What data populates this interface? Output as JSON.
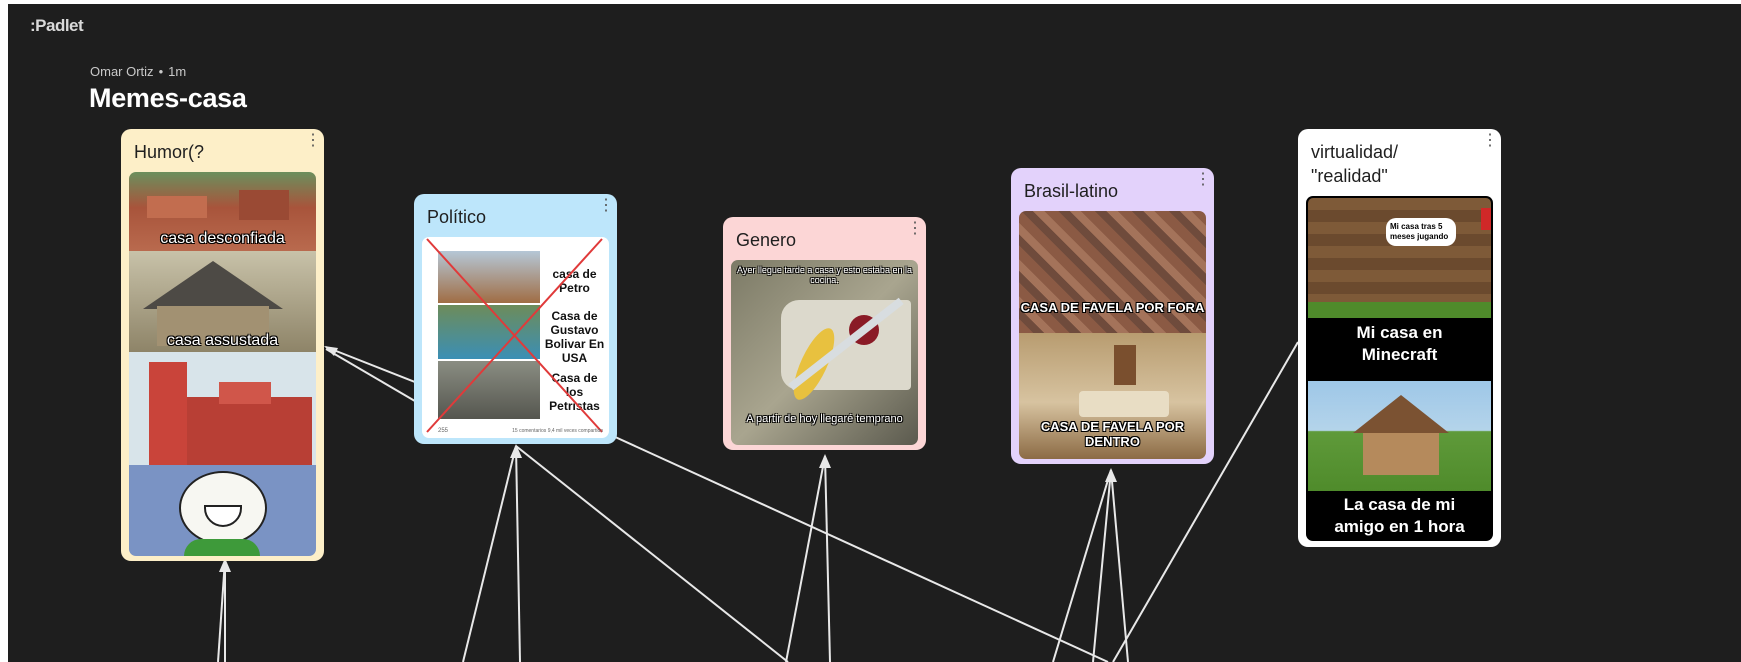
{
  "app": {
    "logo": ":Padlet"
  },
  "board": {
    "author": "Omar Ortiz",
    "time": "1m",
    "title": "Memes-casa"
  },
  "colors": {
    "background": "#1e1e1e",
    "humor": "#fdefc8",
    "politico": "#bde6fb",
    "genero": "#fcd6d6",
    "brasil": "#e3d2fb",
    "virtualidad": "#ffffff"
  },
  "cards": {
    "humor": {
      "title": "Humor(?",
      "captions": [
        "casa desconfiada",
        "casa assustada"
      ]
    },
    "politico": {
      "title": "Político",
      "captions": [
        "casa de Petro",
        "Casa de Gustavo Bolivar En USA",
        "Casa de los Petristas"
      ],
      "footer_left": "255",
      "footer_right": "15 comentarios  9,4 mil veces compartido"
    },
    "genero": {
      "title": "Genero",
      "top_text": "Ayer llegue tarde a casa y esto estaba en la cocina.",
      "bottom_text": "A partir de hoy llegaré temprano"
    },
    "brasil": {
      "title": "Brasil-latino",
      "captions": [
        "CASA DE FAVELA POR FORA",
        "CASA DE FAVELA POR DENTRO"
      ]
    },
    "virtualidad": {
      "title": "virtualidad/ \"realidad\"",
      "bubble": "Mi casa tras 5 meses jugando",
      "caption1": "Mi casa en Minecraft",
      "caption2": "La casa de mi amigo en 1 hora"
    }
  }
}
